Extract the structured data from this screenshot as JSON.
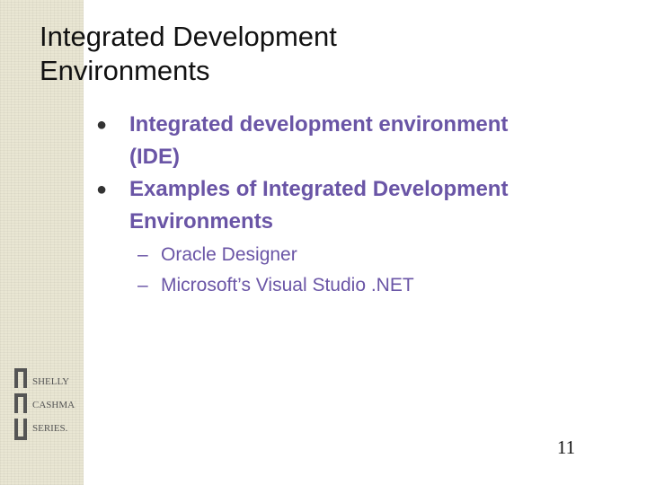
{
  "slide": {
    "title_line1": "Integrated Development",
    "title_line2": "Environments",
    "bullets": [
      {
        "line1": "Integrated development environment",
        "line2": "(IDE)"
      },
      {
        "line1": "Examples of Integrated Development",
        "line2": "Environments"
      }
    ],
    "sub_bullets": [
      "Oracle Designer",
      "Microsoft’s Visual Studio .NET"
    ],
    "bullet_glyph": "●",
    "dash_glyph": "–",
    "page_number": "11"
  },
  "logo": {
    "text_line1": "SHELLY",
    "text_line2": "CASHMAN",
    "text_line3": "SERIES."
  },
  "colors": {
    "bullet_text": "#6a55a6",
    "title_text": "#111111",
    "side_band": "#e9e6d3",
    "logo": "#555555"
  }
}
